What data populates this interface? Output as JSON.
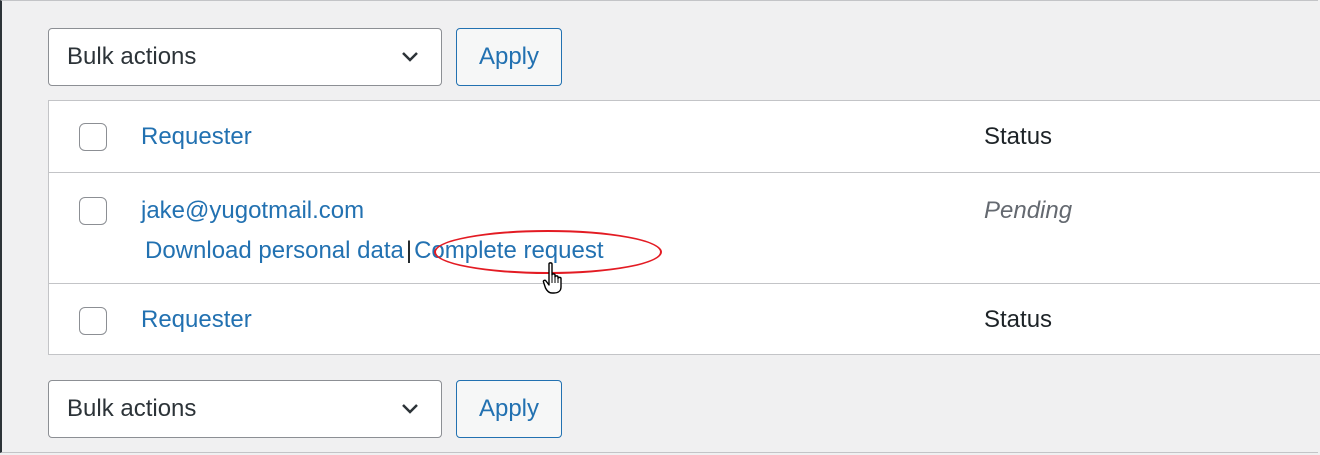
{
  "tablenav_top": {
    "bulk_select": "Bulk actions",
    "apply": "Apply"
  },
  "tablenav_bottom": {
    "bulk_select": "Bulk actions",
    "apply": "Apply"
  },
  "table": {
    "header": {
      "requester": "Requester",
      "status": "Status"
    },
    "rows": [
      {
        "email": "jake@yugotmail.com",
        "status": "Pending",
        "row_actions": {
          "download": "Download personal data",
          "separator": "|",
          "complete": "Complete request"
        }
      }
    ],
    "footer": {
      "requester": "Requester",
      "status": "Status"
    }
  },
  "icons": {
    "dropdown": "chevron-down-icon",
    "cursor": "hand-pointer-icon"
  },
  "colors": {
    "link": "#2271b1",
    "highlight": "#e31b23"
  }
}
